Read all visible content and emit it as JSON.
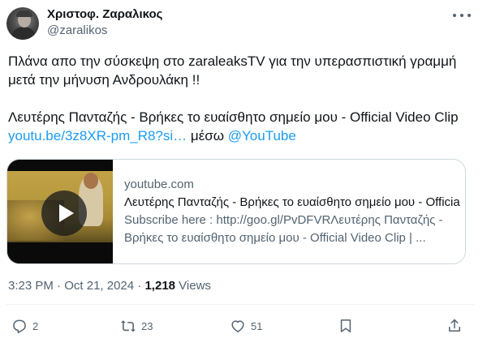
{
  "author": {
    "display_name": "Χριστοφ. Ζαραλικος",
    "handle": "@zaralikos"
  },
  "tweet": {
    "line1": "Πλάνα απο την σύσκεψη στο  zaraleaksTV για  την υπερασπιστική γραμμή μετά την μήνυση Ανδρουλάκη !!",
    "line2_text": "Λευτέρης Πανταζής - Βρήκες το ευαίσθητο σημείο μου - Official Video Clip ",
    "line2_link": "youtu.be/3z8XR-pm_R8?si…",
    "line2_via": " μέσω ",
    "line2_mention": "@YouTube"
  },
  "card": {
    "domain": "youtube.com",
    "title": "Λευτέρης Πανταζής - Βρήκες το ευαίσθητο σημείο μου - Official Video Clip",
    "description": "Subscribe here : http://goo.gl/PvDFVRΛευτέρης Πανταζής - Βρήκες το ευαίσθητο σημείο μου - Official Video Clip | ..."
  },
  "meta": {
    "time": "3:23 PM",
    "separator": " · ",
    "date": "Oct 21, 2024",
    "views_count": "1,218",
    "views_label": " Views"
  },
  "actions": {
    "replies": "2",
    "retweets": "23",
    "likes": "51"
  },
  "icons": {
    "more": "more-horizontal-icon",
    "reply": "reply-icon",
    "retweet": "retweet-icon",
    "like": "heart-icon",
    "bookmark": "bookmark-icon",
    "share": "share-icon",
    "play": "play-icon"
  },
  "colors": {
    "link": "#1d9bf0",
    "text": "#0f1419",
    "secondary": "#536471",
    "border": "#cfd9de"
  }
}
